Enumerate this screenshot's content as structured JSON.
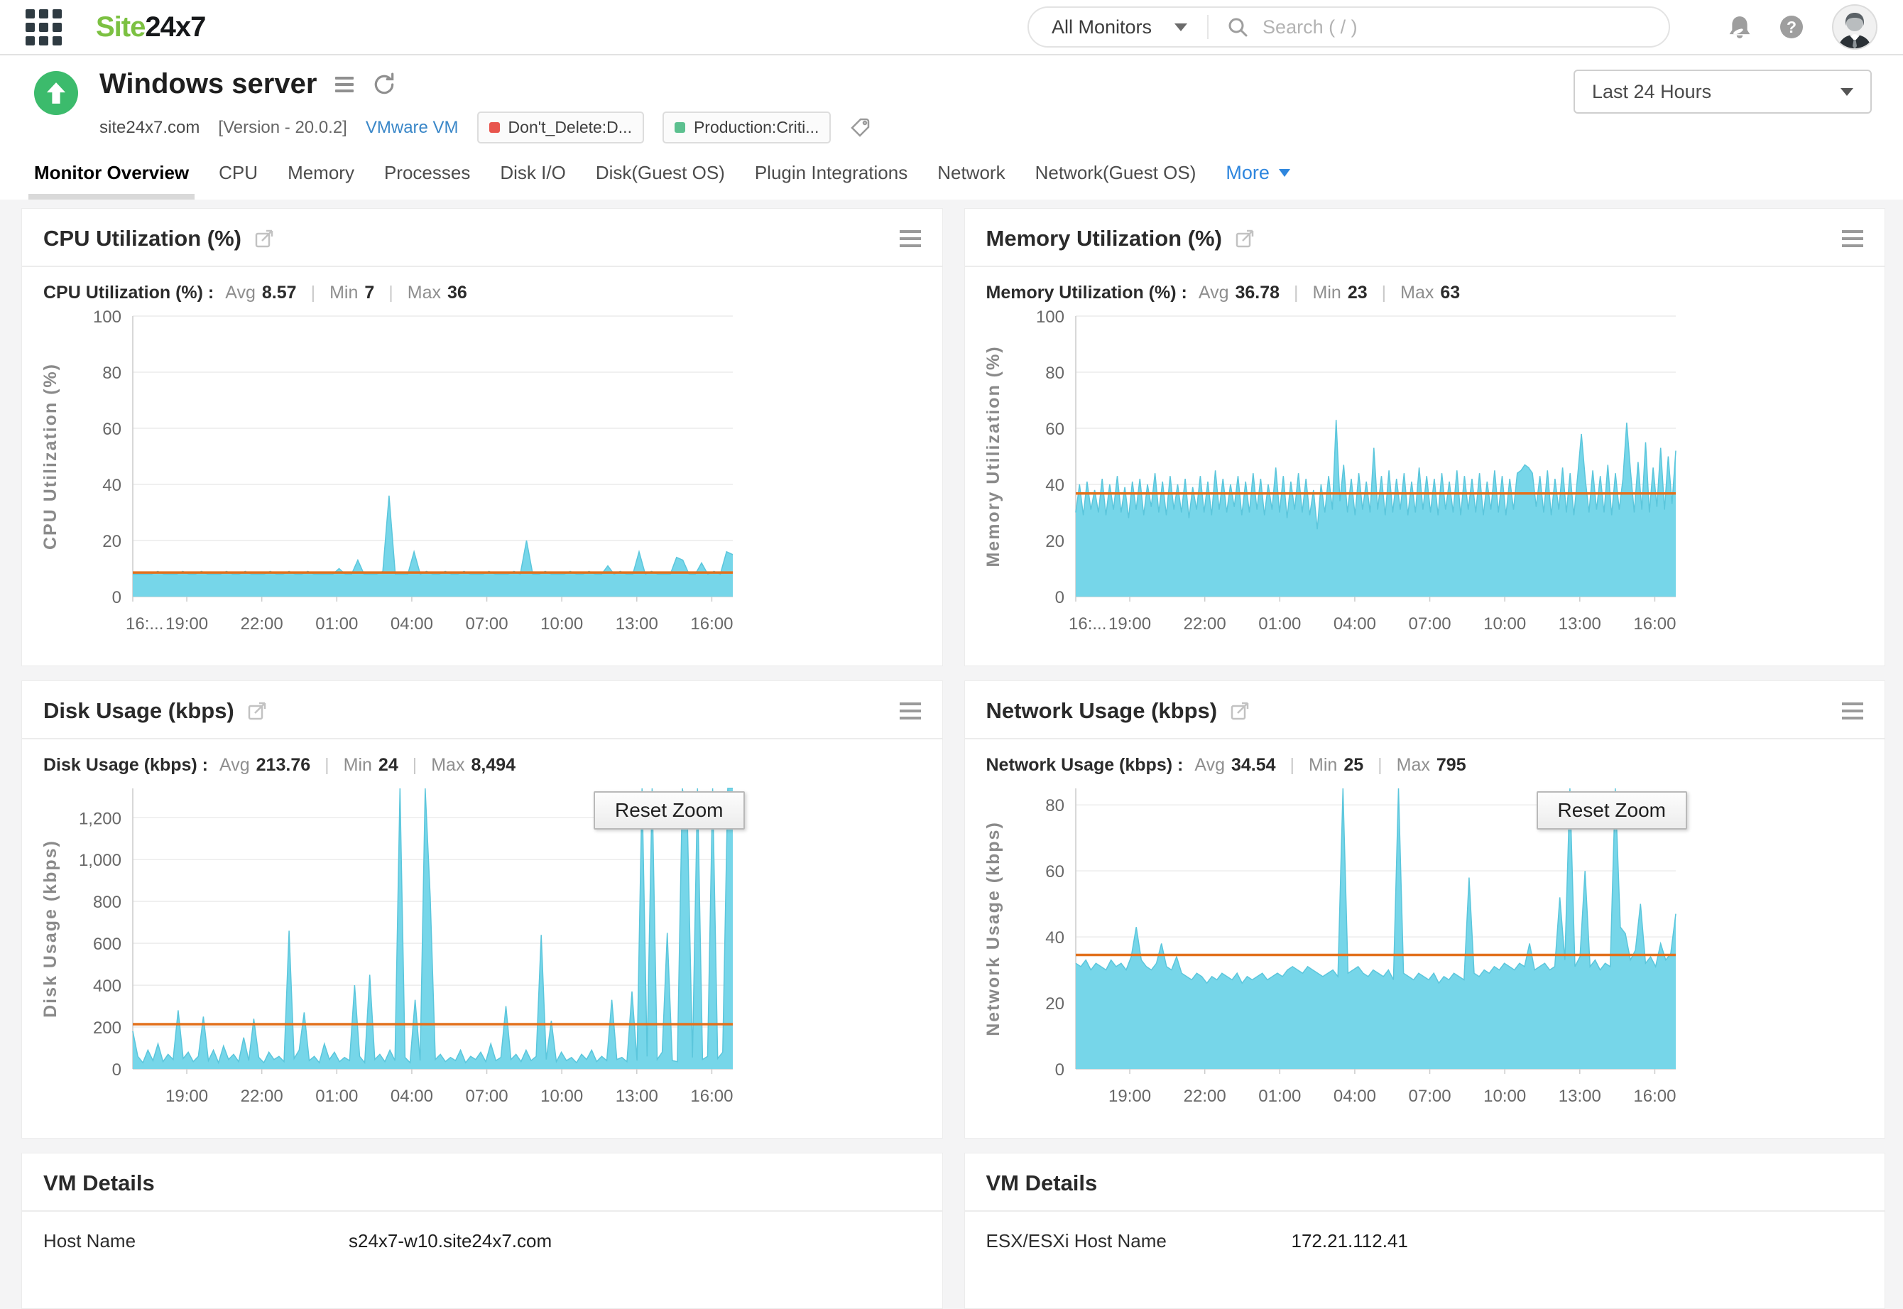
{
  "header": {
    "logo_site": "Site",
    "logo_24x7": "24x7",
    "monitor_scope": "All Monitors",
    "search_placeholder": "Search ( / )"
  },
  "monitor": {
    "title": "Windows server",
    "host": "site24x7.com",
    "version": "[Version - 20.0.2]",
    "type_link": "VMware VM",
    "tags": [
      {
        "label": "Don't_Delete:D...",
        "color": "#e8554d"
      },
      {
        "label": "Production:Criti...",
        "color": "#5cc08f"
      }
    ],
    "time_range": "Last 24 Hours"
  },
  "tabs": {
    "items": [
      "Monitor Overview",
      "CPU",
      "Memory",
      "Processes",
      "Disk I/O",
      "Disk(Guest OS)",
      "Plugin Integrations",
      "Network",
      "Network(Guest OS)"
    ],
    "more_label": "More",
    "active": "Monitor Overview"
  },
  "pipe": "|",
  "reset_zoom_label": "Reset Zoom",
  "colors": {
    "area": "#76d6e9",
    "area_edge": "#5bc6dc",
    "avg_line": "#e2711d",
    "status_green": "#3cbb6c",
    "brand_green": "#7cc142",
    "link_blue": "#3a87c8",
    "more_blue": "#2e86de"
  },
  "charts": [
    {
      "title": "CPU Utilization (%)",
      "metric_label": "CPU Utilization (%) :",
      "stats": {
        "avg_label": "Avg",
        "avg_value": "8.57",
        "min_label": "Min",
        "min_value": "7",
        "max_label": "Max",
        "max_value": "36"
      },
      "y_label": "CPU Utilization (%)",
      "y_max": 100,
      "avg_line": 8.57,
      "y_ticks": [
        {
          "v": 0,
          "label": "0"
        },
        {
          "v": 20,
          "label": "20"
        },
        {
          "v": 40,
          "label": "40"
        },
        {
          "v": 60,
          "label": "60"
        },
        {
          "v": 80,
          "label": "80"
        },
        {
          "v": 100,
          "label": "100"
        }
      ],
      "x_ticks": [
        {
          "label": "16:...",
          "frac": 0,
          "anchor": "start"
        },
        {
          "label": "19:00",
          "frac": 0.09
        },
        {
          "label": "22:00",
          "frac": 0.215
        },
        {
          "label": "01:00",
          "frac": 0.34
        },
        {
          "label": "04:00",
          "frac": 0.465
        },
        {
          "label": "07:00",
          "frac": 0.59
        },
        {
          "label": "10:00",
          "frac": 0.715
        },
        {
          "label": "13:00",
          "frac": 0.84
        },
        {
          "label": "16:00",
          "frac": 0.965
        }
      ],
      "values": [
        8,
        8,
        8,
        8,
        9,
        8,
        8,
        8,
        9,
        8,
        8,
        9,
        8,
        8,
        8,
        9,
        8,
        8,
        9,
        8,
        8,
        8,
        9,
        8,
        8,
        9,
        8,
        8,
        9,
        8,
        8,
        8,
        8,
        10,
        8,
        8,
        13,
        8,
        8,
        8,
        9,
        36,
        8,
        8,
        8,
        16,
        8,
        9,
        8,
        8,
        9,
        8,
        8,
        9,
        8,
        8,
        8,
        9,
        8,
        8,
        8,
        9,
        8,
        20,
        8,
        8,
        9,
        8,
        8,
        8,
        9,
        8,
        8,
        9,
        8,
        8,
        11,
        8,
        9,
        8,
        8,
        16,
        8,
        9,
        8,
        8,
        8,
        14,
        13,
        8,
        8,
        12,
        8,
        9,
        8,
        16,
        15
      ],
      "has_reset_zoom": false
    },
    {
      "title": "Memory Utilization (%)",
      "metric_label": "Memory Utilization (%) :",
      "stats": {
        "avg_label": "Avg",
        "avg_value": "36.78",
        "min_label": "Min",
        "min_value": "23",
        "max_label": "Max",
        "max_value": "63"
      },
      "y_label": "Memory Utilization (%)",
      "y_max": 100,
      "avg_line": 36.78,
      "y_ticks": [
        {
          "v": 0,
          "label": "0"
        },
        {
          "v": 20,
          "label": "20"
        },
        {
          "v": 40,
          "label": "40"
        },
        {
          "v": 60,
          "label": "60"
        },
        {
          "v": 80,
          "label": "80"
        },
        {
          "v": 100,
          "label": "100"
        }
      ],
      "x_ticks": [
        {
          "label": "16:...",
          "frac": 0,
          "anchor": "start"
        },
        {
          "label": "19:00",
          "frac": 0.09
        },
        {
          "label": "22:00",
          "frac": 0.215
        },
        {
          "label": "01:00",
          "frac": 0.34
        },
        {
          "label": "04:00",
          "frac": 0.465
        },
        {
          "label": "07:00",
          "frac": 0.59
        },
        {
          "label": "10:00",
          "frac": 0.715
        },
        {
          "label": "13:00",
          "frac": 0.84
        },
        {
          "label": "16:00",
          "frac": 0.965
        }
      ],
      "values": [
        30,
        40,
        29,
        41,
        31,
        38,
        30,
        42,
        29,
        40,
        31,
        43,
        30,
        39,
        28,
        41,
        31,
        42,
        29,
        40,
        32,
        44,
        30,
        41,
        29,
        43,
        31,
        40,
        30,
        42,
        28,
        39,
        31,
        43,
        30,
        41,
        29,
        45,
        31,
        42,
        30,
        40,
        32,
        43,
        29,
        41,
        30,
        44,
        31,
        42,
        29,
        40,
        31,
        46,
        30,
        43,
        28,
        41,
        31,
        44,
        30,
        42,
        29,
        38,
        24,
        40,
        30,
        43,
        31,
        63,
        34,
        47,
        30,
        42,
        29,
        44,
        31,
        41,
        30,
        53,
        31,
        43,
        29,
        45,
        30,
        42,
        31,
        44,
        29,
        41,
        30,
        46,
        31,
        43,
        30,
        42,
        29,
        44,
        31,
        41,
        30,
        45,
        29,
        43,
        31,
        42,
        30,
        44,
        29,
        41,
        31,
        45,
        30,
        43,
        29,
        42,
        31,
        44,
        45,
        47,
        46,
        44,
        32,
        43,
        30,
        45,
        29,
        42,
        31,
        46,
        30,
        44,
        29,
        43,
        58,
        42,
        30,
        45,
        31,
        43,
        30,
        47,
        29,
        44,
        31,
        42,
        62,
        45,
        30,
        48,
        31,
        55,
        30,
        46,
        32,
        53,
        31,
        50,
        33,
        52
      ],
      "has_reset_zoom": false
    },
    {
      "title": "Disk Usage (kbps)",
      "metric_label": "Disk Usage (kbps) :",
      "stats": {
        "avg_label": "Avg",
        "avg_value": "213.76",
        "min_label": "Min",
        "min_value": "24",
        "max_label": "Max",
        "max_value": "8,494"
      },
      "y_label": "Disk Usage (kbps)",
      "y_max": 1340,
      "avg_line": 213.76,
      "y_ticks": [
        {
          "v": 0,
          "label": "0"
        },
        {
          "v": 200,
          "label": "200"
        },
        {
          "v": 400,
          "label": "400"
        },
        {
          "v": 600,
          "label": "600"
        },
        {
          "v": 800,
          "label": "800"
        },
        {
          "v": 1000,
          "label": "1,000"
        },
        {
          "v": 1200,
          "label": "1,200"
        }
      ],
      "x_ticks": [
        {
          "label": "19:00",
          "frac": 0.09
        },
        {
          "label": "22:00",
          "frac": 0.215
        },
        {
          "label": "01:00",
          "frac": 0.34
        },
        {
          "label": "04:00",
          "frac": 0.465
        },
        {
          "label": "07:00",
          "frac": 0.59
        },
        {
          "label": "10:00",
          "frac": 0.715
        },
        {
          "label": "13:00",
          "frac": 0.84
        },
        {
          "label": "16:00",
          "frac": 0.965
        }
      ],
      "values": [
        180,
        60,
        30,
        90,
        40,
        120,
        35,
        70,
        45,
        280,
        50,
        80,
        35,
        60,
        250,
        40,
        90,
        30,
        110,
        45,
        70,
        35,
        150,
        40,
        240,
        55,
        30,
        80,
        45,
        60,
        35,
        660,
        50,
        90,
        270,
        40,
        60,
        30,
        120,
        45,
        80,
        35,
        55,
        40,
        400,
        60,
        30,
        450,
        45,
        70,
        35,
        90,
        40,
        1340,
        55,
        30,
        330,
        40,
        1340,
        820,
        45,
        70,
        35,
        55,
        40,
        90,
        30,
        60,
        45,
        80,
        35,
        120,
        40,
        55,
        300,
        45,
        70,
        35,
        90,
        40,
        60,
        640,
        45,
        230,
        35,
        80,
        40,
        55,
        30,
        70,
        45,
        90,
        35,
        60,
        40,
        330,
        45,
        55,
        35,
        370,
        40,
        1340,
        60,
        1340,
        45,
        80,
        650,
        40,
        35,
        1340,
        1180,
        55,
        1340,
        45,
        60,
        1340,
        50,
        80,
        1340,
        1340
      ],
      "has_reset_zoom": true
    },
    {
      "title": "Network Usage (kbps)",
      "metric_label": "Network Usage (kbps) :",
      "stats": {
        "avg_label": "Avg",
        "avg_value": "34.54",
        "min_label": "Min",
        "min_value": "25",
        "max_label": "Max",
        "max_value": "795"
      },
      "y_label": "Network Usage (kbps)",
      "y_max": 85,
      "avg_line": 34.54,
      "y_ticks": [
        {
          "v": 0,
          "label": "0"
        },
        {
          "v": 20,
          "label": "20"
        },
        {
          "v": 40,
          "label": "40"
        },
        {
          "v": 60,
          "label": "60"
        },
        {
          "v": 80,
          "label": "80"
        }
      ],
      "x_ticks": [
        {
          "label": "19:00",
          "frac": 0.09
        },
        {
          "label": "22:00",
          "frac": 0.215
        },
        {
          "label": "01:00",
          "frac": 0.34
        },
        {
          "label": "04:00",
          "frac": 0.465
        },
        {
          "label": "07:00",
          "frac": 0.59
        },
        {
          "label": "10:00",
          "frac": 0.715
        },
        {
          "label": "13:00",
          "frac": 0.84
        },
        {
          "label": "16:00",
          "frac": 0.965
        }
      ],
      "values": [
        32,
        31,
        33,
        30,
        32,
        31,
        30,
        33,
        31,
        32,
        30,
        34,
        43,
        33,
        31,
        30,
        32,
        38,
        31,
        30,
        34,
        29,
        28,
        27,
        29,
        28,
        26,
        28,
        27,
        29,
        28,
        27,
        29,
        26,
        28,
        27,
        28,
        29,
        27,
        28,
        29,
        28,
        30,
        31,
        30,
        29,
        31,
        30,
        29,
        28,
        29,
        30,
        28,
        85,
        29,
        30,
        31,
        29,
        28,
        30,
        29,
        28,
        30,
        27,
        85,
        29,
        28,
        27,
        29,
        28,
        27,
        29,
        26,
        28,
        27,
        29,
        28,
        27,
        58,
        29,
        28,
        30,
        29,
        31,
        30,
        32,
        31,
        30,
        32,
        31,
        38,
        30,
        31,
        32,
        30,
        31,
        52,
        33,
        85,
        31,
        34,
        60,
        31,
        33,
        30,
        32,
        31,
        85,
        43,
        41,
        33,
        36,
        50,
        32,
        34,
        31,
        38,
        33,
        35,
        47
      ],
      "has_reset_zoom": true
    }
  ],
  "chart_data": [
    {
      "type": "area",
      "title": "CPU Utilization (%)",
      "ylabel": "CPU Utilization (%)",
      "ylim": [
        0,
        100
      ],
      "x_ticks": [
        "16:...",
        "19:00",
        "22:00",
        "01:00",
        "04:00",
        "07:00",
        "10:00",
        "13:00",
        "16:00"
      ],
      "summary": {
        "avg": 8.57,
        "min": 7,
        "max": 36
      },
      "avg_reference_line": 8.57,
      "grid": true,
      "legend": false
    },
    {
      "type": "area",
      "title": "Memory Utilization (%)",
      "ylabel": "Memory Utilization (%)",
      "ylim": [
        0,
        100
      ],
      "x_ticks": [
        "16:...",
        "19:00",
        "22:00",
        "01:00",
        "04:00",
        "07:00",
        "10:00",
        "13:00",
        "16:00"
      ],
      "summary": {
        "avg": 36.78,
        "min": 23,
        "max": 63
      },
      "avg_reference_line": 36.78,
      "grid": true,
      "legend": false
    },
    {
      "type": "area",
      "title": "Disk Usage (kbps)",
      "ylabel": "Disk Usage (kbps)",
      "ylim": [
        0,
        1340
      ],
      "x_ticks": [
        "19:00",
        "22:00",
        "01:00",
        "04:00",
        "07:00",
        "10:00",
        "13:00",
        "16:00"
      ],
      "summary": {
        "avg": 213.76,
        "min": 24,
        "max": 8494
      },
      "avg_reference_line": 213.76,
      "grid": true,
      "legend": false
    },
    {
      "type": "area",
      "title": "Network Usage (kbps)",
      "ylabel": "Network Usage (kbps)",
      "ylim": [
        0,
        85
      ],
      "x_ticks": [
        "19:00",
        "22:00",
        "01:00",
        "04:00",
        "07:00",
        "10:00",
        "13:00",
        "16:00"
      ],
      "summary": {
        "avg": 34.54,
        "min": 25,
        "max": 795
      },
      "avg_reference_line": 34.54,
      "grid": true,
      "legend": false
    }
  ],
  "vm_details_left": {
    "title": "VM Details",
    "rows": [
      {
        "label": "Host Name",
        "value": "s24x7-w10.site24x7.com"
      }
    ]
  },
  "vm_details_right": {
    "title": "VM Details",
    "rows": [
      {
        "label": "ESX/ESXi Host Name",
        "value": "172.21.112.41"
      }
    ]
  }
}
